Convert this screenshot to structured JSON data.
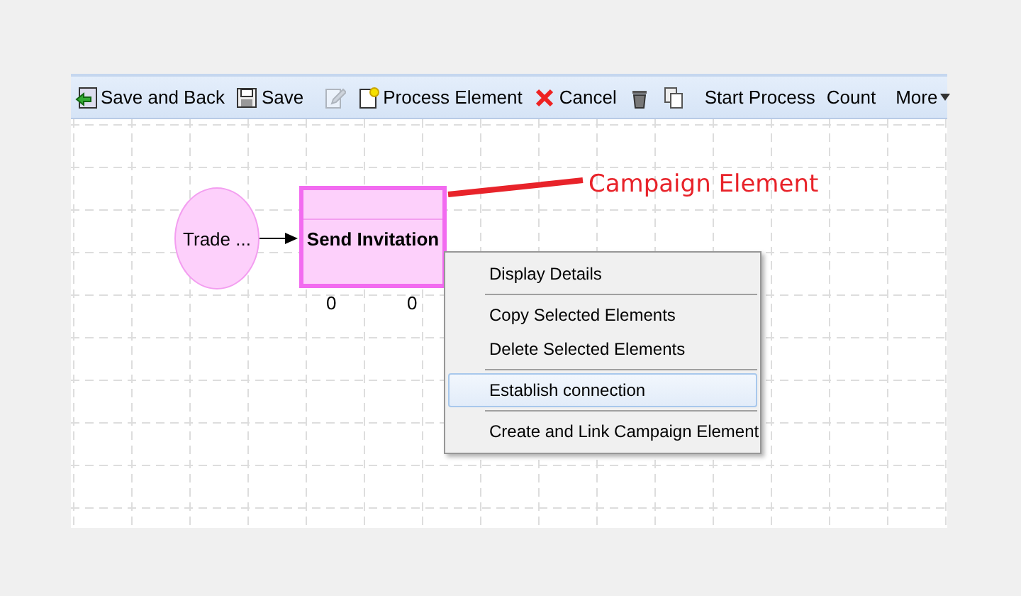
{
  "toolbar": [
    {
      "kind": "button",
      "label": "Save and Back",
      "disabled": false
    },
    {
      "kind": "button",
      "label": "Save",
      "disabled": false
    },
    {
      "kind": "separator"
    },
    {
      "kind": "button",
      "disabled": true
    },
    {
      "kind": "button",
      "label": "Process Element",
      "disabled": false
    },
    {
      "kind": "button",
      "label": "Cancel",
      "disabled": false
    },
    {
      "kind": "button",
      "disabled": false
    },
    {
      "kind": "button",
      "disabled": false
    },
    {
      "kind": "separator"
    },
    {
      "kind": "button",
      "label": "Start Process",
      "disabled": false
    },
    {
      "kind": "button",
      "label": "Count",
      "disabled": false
    },
    {
      "kind": "separator"
    },
    {
      "kind": "dropdown",
      "label": "More",
      "disabled": false
    }
  ],
  "canvas": {
    "start_node": {
      "label": "Trade ..."
    },
    "element": {
      "title": "Send Invitation",
      "counts": [
        "0",
        "0"
      ],
      "selected": true
    },
    "annotation": "Campaign Element"
  },
  "context_menu": {
    "groups": [
      [
        {
          "label": "Display Details",
          "selected": false
        }
      ],
      [
        {
          "label": "Copy Selected Elements",
          "selected": false
        },
        {
          "label": "Delete Selected Elements",
          "selected": false
        }
      ],
      [
        {
          "label": "Establish connection",
          "selected": true
        }
      ],
      [
        {
          "label": "Create and Link Campaign Element",
          "selected": false
        }
      ]
    ]
  }
}
